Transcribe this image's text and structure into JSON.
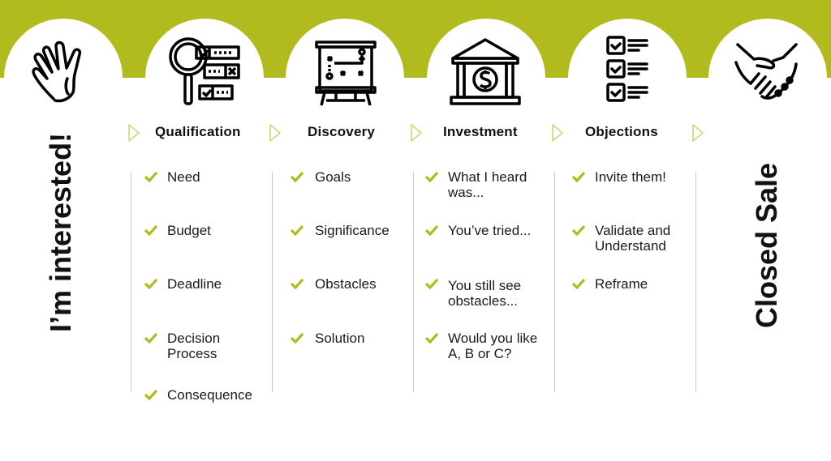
{
  "colors": {
    "accent": "#b2bb1e",
    "divider": "#cfd47a",
    "text": "#111111"
  },
  "start_label": "I’m interested!",
  "end_label": "Closed Sale",
  "icons": [
    {
      "name": "waving-hand-icon"
    },
    {
      "name": "magnifier-checklist-icon"
    },
    {
      "name": "strategy-board-icon"
    },
    {
      "name": "bank-dollar-icon"
    },
    {
      "name": "checklist-icon"
    },
    {
      "name": "handshake-icon"
    }
  ],
  "stages": [
    {
      "title": "Qualification",
      "items": [
        "Need",
        "Budget",
        "Deadline",
        "Decision Process",
        "Consequence"
      ]
    },
    {
      "title": "Discovery",
      "items": [
        "Goals",
        "Significance",
        "Obstacles",
        "Solution"
      ]
    },
    {
      "title": "Investment",
      "items": [
        "What I heard was...",
        "You’ve tried...",
        "You still see obstacles...",
        "Would you like A, B or C?"
      ]
    },
    {
      "title": "Objections",
      "items": [
        "Invite them!",
        "Validate and Understand",
        "Reframe"
      ]
    }
  ]
}
